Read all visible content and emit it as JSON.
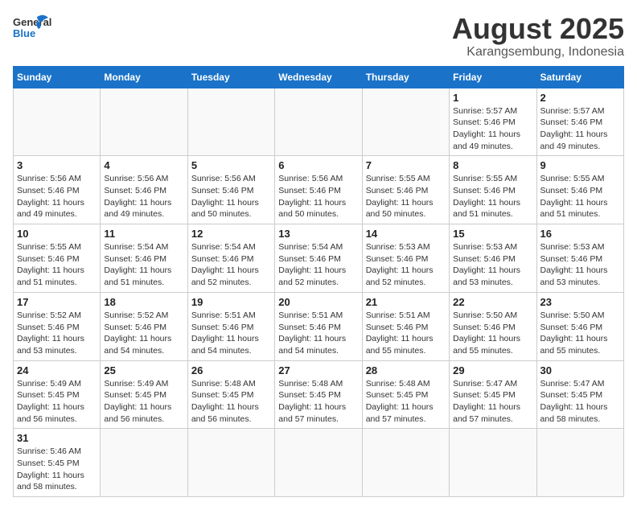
{
  "title": "August 2025",
  "subtitle": "Karangsembung, Indonesia",
  "logo": {
    "general": "General",
    "blue": "Blue"
  },
  "days_of_week": [
    "Sunday",
    "Monday",
    "Tuesday",
    "Wednesday",
    "Thursday",
    "Friday",
    "Saturday"
  ],
  "weeks": [
    [
      {
        "day": "",
        "info": ""
      },
      {
        "day": "",
        "info": ""
      },
      {
        "day": "",
        "info": ""
      },
      {
        "day": "",
        "info": ""
      },
      {
        "day": "",
        "info": ""
      },
      {
        "day": "1",
        "info": "Sunrise: 5:57 AM\nSunset: 5:46 PM\nDaylight: 11 hours\nand 49 minutes."
      },
      {
        "day": "2",
        "info": "Sunrise: 5:57 AM\nSunset: 5:46 PM\nDaylight: 11 hours\nand 49 minutes."
      }
    ],
    [
      {
        "day": "3",
        "info": "Sunrise: 5:56 AM\nSunset: 5:46 PM\nDaylight: 11 hours\nand 49 minutes."
      },
      {
        "day": "4",
        "info": "Sunrise: 5:56 AM\nSunset: 5:46 PM\nDaylight: 11 hours\nand 49 minutes."
      },
      {
        "day": "5",
        "info": "Sunrise: 5:56 AM\nSunset: 5:46 PM\nDaylight: 11 hours\nand 50 minutes."
      },
      {
        "day": "6",
        "info": "Sunrise: 5:56 AM\nSunset: 5:46 PM\nDaylight: 11 hours\nand 50 minutes."
      },
      {
        "day": "7",
        "info": "Sunrise: 5:55 AM\nSunset: 5:46 PM\nDaylight: 11 hours\nand 50 minutes."
      },
      {
        "day": "8",
        "info": "Sunrise: 5:55 AM\nSunset: 5:46 PM\nDaylight: 11 hours\nand 51 minutes."
      },
      {
        "day": "9",
        "info": "Sunrise: 5:55 AM\nSunset: 5:46 PM\nDaylight: 11 hours\nand 51 minutes."
      }
    ],
    [
      {
        "day": "10",
        "info": "Sunrise: 5:55 AM\nSunset: 5:46 PM\nDaylight: 11 hours\nand 51 minutes."
      },
      {
        "day": "11",
        "info": "Sunrise: 5:54 AM\nSunset: 5:46 PM\nDaylight: 11 hours\nand 51 minutes."
      },
      {
        "day": "12",
        "info": "Sunrise: 5:54 AM\nSunset: 5:46 PM\nDaylight: 11 hours\nand 52 minutes."
      },
      {
        "day": "13",
        "info": "Sunrise: 5:54 AM\nSunset: 5:46 PM\nDaylight: 11 hours\nand 52 minutes."
      },
      {
        "day": "14",
        "info": "Sunrise: 5:53 AM\nSunset: 5:46 PM\nDaylight: 11 hours\nand 52 minutes."
      },
      {
        "day": "15",
        "info": "Sunrise: 5:53 AM\nSunset: 5:46 PM\nDaylight: 11 hours\nand 53 minutes."
      },
      {
        "day": "16",
        "info": "Sunrise: 5:53 AM\nSunset: 5:46 PM\nDaylight: 11 hours\nand 53 minutes."
      }
    ],
    [
      {
        "day": "17",
        "info": "Sunrise: 5:52 AM\nSunset: 5:46 PM\nDaylight: 11 hours\nand 53 minutes."
      },
      {
        "day": "18",
        "info": "Sunrise: 5:52 AM\nSunset: 5:46 PM\nDaylight: 11 hours\nand 54 minutes."
      },
      {
        "day": "19",
        "info": "Sunrise: 5:51 AM\nSunset: 5:46 PM\nDaylight: 11 hours\nand 54 minutes."
      },
      {
        "day": "20",
        "info": "Sunrise: 5:51 AM\nSunset: 5:46 PM\nDaylight: 11 hours\nand 54 minutes."
      },
      {
        "day": "21",
        "info": "Sunrise: 5:51 AM\nSunset: 5:46 PM\nDaylight: 11 hours\nand 55 minutes."
      },
      {
        "day": "22",
        "info": "Sunrise: 5:50 AM\nSunset: 5:46 PM\nDaylight: 11 hours\nand 55 minutes."
      },
      {
        "day": "23",
        "info": "Sunrise: 5:50 AM\nSunset: 5:46 PM\nDaylight: 11 hours\nand 55 minutes."
      }
    ],
    [
      {
        "day": "24",
        "info": "Sunrise: 5:49 AM\nSunset: 5:45 PM\nDaylight: 11 hours\nand 56 minutes."
      },
      {
        "day": "25",
        "info": "Sunrise: 5:49 AM\nSunset: 5:45 PM\nDaylight: 11 hours\nand 56 minutes."
      },
      {
        "day": "26",
        "info": "Sunrise: 5:48 AM\nSunset: 5:45 PM\nDaylight: 11 hours\nand 56 minutes."
      },
      {
        "day": "27",
        "info": "Sunrise: 5:48 AM\nSunset: 5:45 PM\nDaylight: 11 hours\nand 57 minutes."
      },
      {
        "day": "28",
        "info": "Sunrise: 5:48 AM\nSunset: 5:45 PM\nDaylight: 11 hours\nand 57 minutes."
      },
      {
        "day": "29",
        "info": "Sunrise: 5:47 AM\nSunset: 5:45 PM\nDaylight: 11 hours\nand 57 minutes."
      },
      {
        "day": "30",
        "info": "Sunrise: 5:47 AM\nSunset: 5:45 PM\nDaylight: 11 hours\nand 58 minutes."
      }
    ],
    [
      {
        "day": "31",
        "info": "Sunrise: 5:46 AM\nSunset: 5:45 PM\nDaylight: 11 hours\nand 58 minutes."
      },
      {
        "day": "",
        "info": ""
      },
      {
        "day": "",
        "info": ""
      },
      {
        "day": "",
        "info": ""
      },
      {
        "day": "",
        "info": ""
      },
      {
        "day": "",
        "info": ""
      },
      {
        "day": "",
        "info": ""
      }
    ]
  ]
}
